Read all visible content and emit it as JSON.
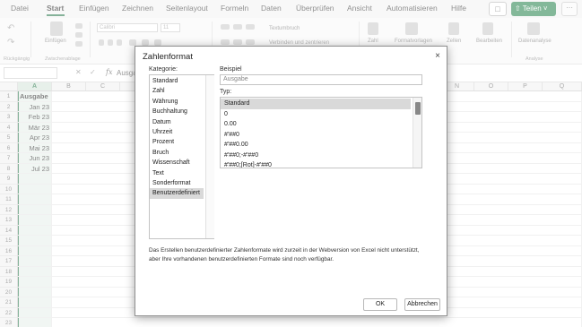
{
  "menu": {
    "items": [
      "Datei",
      "Start",
      "Einfügen",
      "Zeichnen",
      "Seitenlayout",
      "Formeln",
      "Daten",
      "Überprüfen",
      "Ansicht",
      "Automatisieren",
      "Hilfe"
    ],
    "active": "Start",
    "share_label": "Teilen",
    "more_label": "···"
  },
  "ribbon": {
    "paste_label": "Einfügen",
    "font_name": "Calibri",
    "font_size": "11",
    "wrap_label": "Textumbruch",
    "merge_label": "Verbinden und zentrieren",
    "number_label": "Zahl",
    "cond_format_label": "Formatvorlagen",
    "cells_label": "Zellen",
    "edit_label": "Bearbeiten",
    "analysis_label": "Datenanalyse",
    "group_undo": "Rückgängig",
    "group_clipboard": "Zwischenablage",
    "group_analysis": "Analyse"
  },
  "formula_bar": {
    "fx": "fx",
    "value": "Ausgabe"
  },
  "sheet": {
    "columns": [
      "A",
      "B",
      "C",
      "",
      "",
      "",
      "",
      "",
      "",
      "",
      "",
      "",
      "",
      "N",
      "O",
      "P",
      "Q"
    ],
    "rows": [
      "1",
      "2",
      "3",
      "4",
      "5",
      "6",
      "7",
      "8",
      "9",
      "10",
      "11",
      "12",
      "13",
      "14",
      "15",
      "16",
      "17",
      "18",
      "19",
      "20",
      "21",
      "22",
      "23"
    ],
    "col_a_values": [
      "Ausgabe",
      "Jan 23",
      "Feb 23",
      "Mär 23",
      "Apr 23",
      "Mai 23",
      "Jun 23",
      "Jul 23"
    ]
  },
  "dialog": {
    "title": "Zahlenformat",
    "close": "×",
    "category_label": "Kategorie:",
    "categories": [
      "Standard",
      "Zahl",
      "Währung",
      "Buchhaltung",
      "Datum",
      "Uhrzeit",
      "Prozent",
      "Bruch",
      "Wissenschaft",
      "Text",
      "Sonderformat",
      "Benutzerdefiniert"
    ],
    "selected_category": "Benutzerdefiniert",
    "sample_label": "Beispiel",
    "sample_value": "Ausgabe",
    "type_label": "Typ:",
    "types": [
      "Standard",
      "0",
      "0.00",
      "#'##0",
      "#'##0.00",
      "#'##0;-#'##0",
      "#'##0;[Rot]-#'##0"
    ],
    "selected_type": "Standard",
    "info_text": "Das Erstellen benutzerdefinierter Zahlenformate wird zurzeit in der Webversion von Excel nicht unterstützt, aber Ihre vorhandenen benutzerdefinierten Formate sind noch verfügbar.",
    "ok_label": "OK",
    "cancel_label": "Abbrechen"
  },
  "colors": {
    "accent": "#217346",
    "share": "#1e7e45",
    "selection": "#d9d9d9"
  }
}
